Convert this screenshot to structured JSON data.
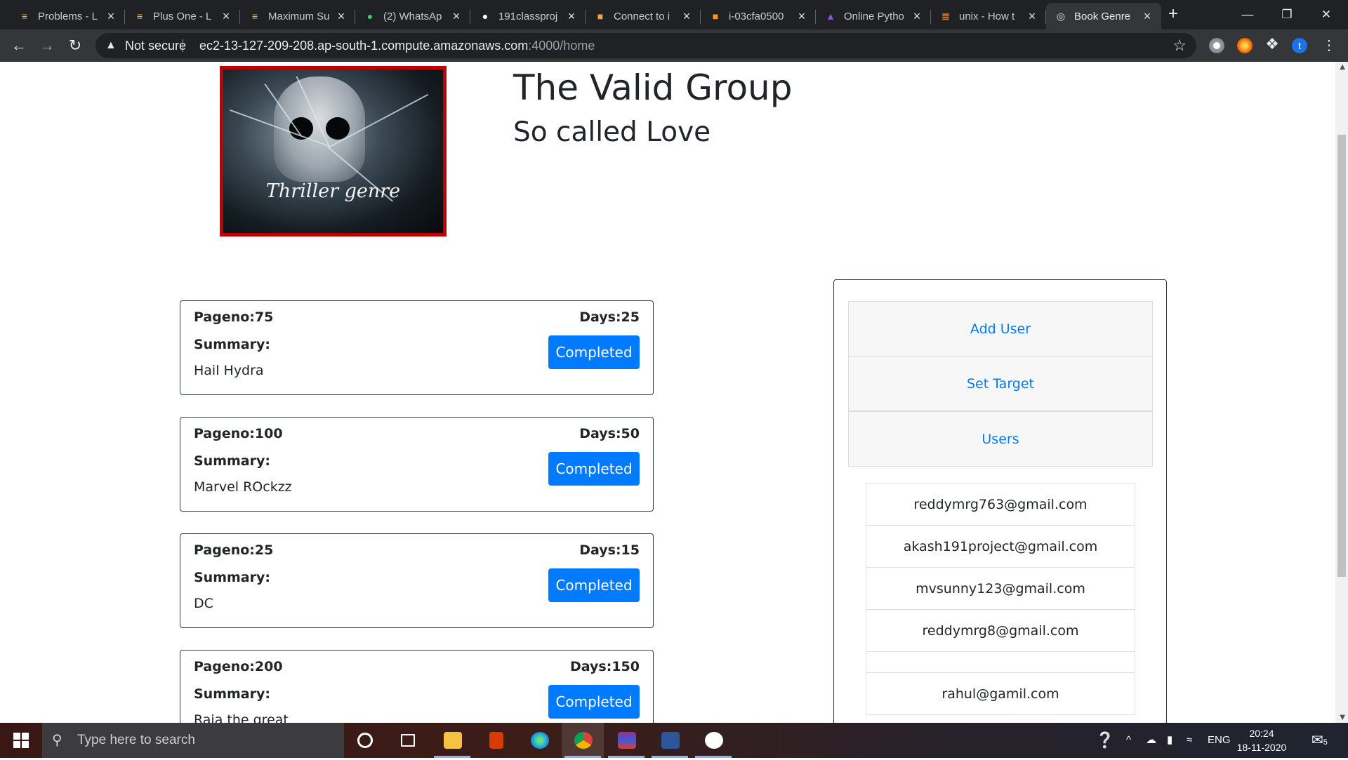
{
  "browser": {
    "tabs": [
      {
        "label": "Problems - L",
        "favicon": "hackerrank-icon",
        "color": "#f5b443"
      },
      {
        "label": "Plus One - L",
        "favicon": "hackerrank-icon",
        "color": "#f5b443"
      },
      {
        "label": "Maximum Su",
        "favicon": "hackerrank-icon",
        "color": "#f5b443"
      },
      {
        "label": "(2) WhatsAp",
        "favicon": "whatsapp-icon",
        "color": "#25d366"
      },
      {
        "label": "191classproj",
        "favicon": "github-icon",
        "color": "#ffffff"
      },
      {
        "label": "Connect to i",
        "favicon": "aws-icon",
        "color": "#f2a33a"
      },
      {
        "label": "i-03cfa0500",
        "favicon": "aws-icon",
        "color": "#ff9900"
      },
      {
        "label": "Online Pytho",
        "favicon": "python-icon",
        "color": "#8a4fff"
      },
      {
        "label": "unix - How t",
        "favicon": "stackoverflow-icon",
        "color": "#f48024"
      },
      {
        "label": "Book Genre",
        "favicon": "globe-icon",
        "color": "#9aa0a6",
        "active": true
      }
    ],
    "security_label": "Not secure",
    "url_host": "ec2-13-127-209-208.ap-south-1.compute.amazonaws.com",
    "url_path": ":4000/home",
    "profile_initial": "t"
  },
  "page": {
    "title": "The Valid Group",
    "subtitle": "So called Love",
    "hero_caption": "Thriller genre",
    "cards": [
      {
        "pageno": "Pageno:75",
        "days": "Days:25",
        "summary_label": "Summary:",
        "summary": "Hail Hydra",
        "button": "Completed"
      },
      {
        "pageno": "Pageno:100",
        "days": "Days:50",
        "summary_label": "Summary:",
        "summary": "Marvel ROckzz",
        "button": "Completed"
      },
      {
        "pageno": "Pageno:25",
        "days": "Days:15",
        "summary_label": "Summary:",
        "summary": "DC",
        "button": "Completed"
      },
      {
        "pageno": "Pageno:200",
        "days": "Days:150",
        "summary_label": "Summary:",
        "summary": "Raja the great",
        "button": "Completed"
      }
    ],
    "panel": {
      "items": [
        "Add User",
        "Set Target",
        "Users"
      ],
      "users": [
        "reddymrg763@gmail.com",
        "akash191project@gmail.com",
        "mvsunny123@gmail.com",
        "reddymrg8@gmail.com",
        "",
        "rahul@gamil.com"
      ]
    }
  },
  "taskbar": {
    "search_placeholder": "Type here to search",
    "language": "ENG",
    "time": "20:24",
    "date": "18-11-2020",
    "notification_count": "5"
  }
}
